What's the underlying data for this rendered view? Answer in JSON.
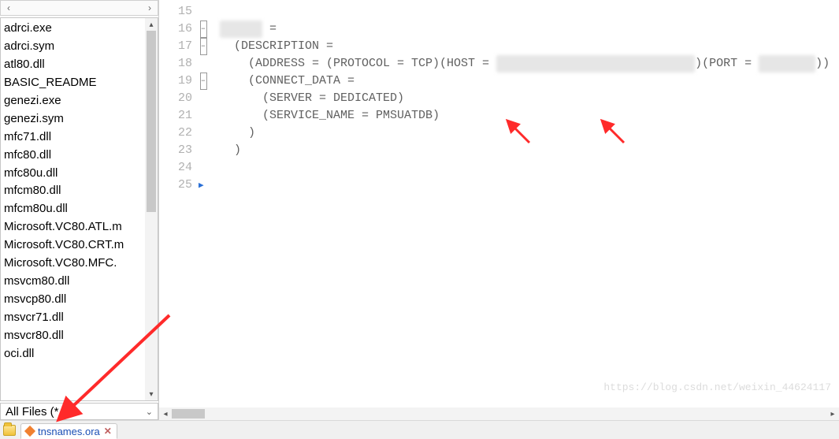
{
  "sidebar": {
    "nav_left": "‹",
    "nav_right": "›",
    "files": [
      "adrci.exe",
      "adrci.sym",
      "atl80.dll",
      "BASIC_README",
      "genezi.exe",
      "genezi.sym",
      "mfc71.dll",
      "mfc80.dll",
      "mfc80u.dll",
      "mfcm80.dll",
      "mfcm80u.dll",
      "Microsoft.VC80.ATL.m",
      "Microsoft.VC80.CRT.m",
      "Microsoft.VC80.MFC.",
      "msvcm80.dll",
      "msvcp80.dll",
      "msvcr71.dll",
      "msvcr80.dll",
      "oci.dll"
    ],
    "filter_label": "All Files (*.*)"
  },
  "editor": {
    "lines": [
      {
        "num": "15",
        "fold": "",
        "text": ""
      },
      {
        "num": "16",
        "fold": "−",
        "text": " ▒▒▒ ="
      },
      {
        "num": "17",
        "fold": "−",
        "text": "   (DESCRIPTION ="
      },
      {
        "num": "18",
        "fold": "",
        "text": "     (ADDRESS = (PROTOCOL = TCP)(HOST = ▒▒▒▒▒▒▒▒▒▒▒▒▒▒)(PORT = ▒▒▒▒))"
      },
      {
        "num": "19",
        "fold": "−",
        "text": "     (CONNECT_DATA ="
      },
      {
        "num": "20",
        "fold": "",
        "text": "       (SERVER = DEDICATED)"
      },
      {
        "num": "21",
        "fold": "",
        "text": "       (SERVICE_NAME = PMSUATDB)"
      },
      {
        "num": "22",
        "fold": "",
        "text": "     )"
      },
      {
        "num": "23",
        "fold": "",
        "text": "   )"
      },
      {
        "num": "24",
        "fold": "",
        "text": ""
      },
      {
        "num": "25",
        "fold": "▶",
        "text": ""
      }
    ]
  },
  "tab": {
    "label": "tnsnames.ora"
  },
  "watermark": "https://blog.csdn.net/weixin_44624117"
}
